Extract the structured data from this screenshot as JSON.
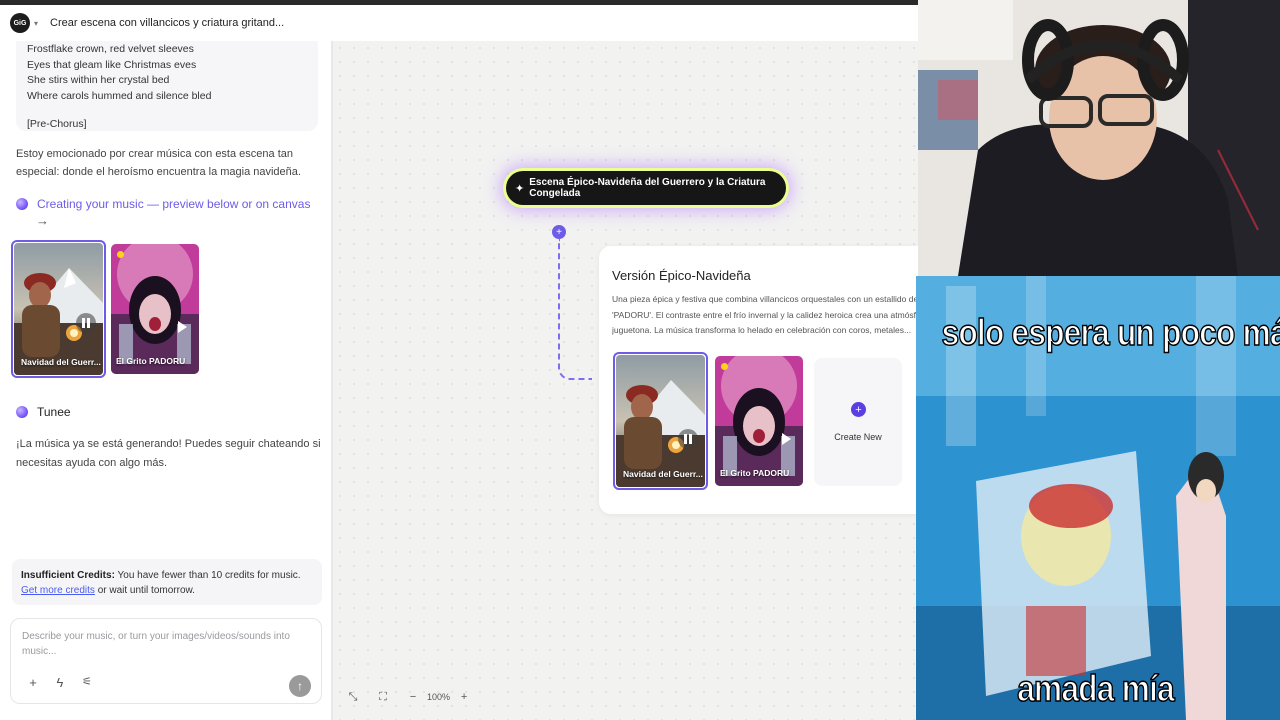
{
  "header": {
    "logo_text": "GiG",
    "title": "Crear escena con villancicos y criatura gritand..."
  },
  "chat": {
    "lyrics": [
      "Frostflake crown, red velvet sleeves",
      "Eyes that gleam like Christmas eves",
      "She stirs within her crystal bed",
      "Where carols hummed and silence bled"
    ],
    "lyrics_tag": "[Pre-Chorus]",
    "assistant_message": "Estoy emocionado por crear música con esta escena tan especial: donde el heroísmo encuentra la magia navideña.",
    "creating_label": "Creating your music — preview below or on canvas",
    "creating_arrow": "→",
    "tracks": [
      {
        "title": "Navidad del Guerr...",
        "state": "playing"
      },
      {
        "title": "El Grito PADORU",
        "state": "paused"
      }
    ],
    "tunee_name": "Tunee",
    "tunee_message": "¡La música ya se está generando! Puedes seguir chateando si necesitas ayuda con algo más.",
    "credits": {
      "bold": "Insufficient Credits:",
      "text": " You have fewer than 10 credits for music.",
      "link": "Get more credits",
      "tail": " or wait until tomorrow."
    },
    "prompt_placeholder": "Describe your music, or turn your images/videos/sounds into music..."
  },
  "canvas": {
    "scene_title": "Escena Épico-Navideña del Guerrero y la Criatura Congelada",
    "version_title": "Versión Épico-Navideña",
    "version_description": "Una pieza épica y festiva que combina villancicos orquestales con un estallido de 'PADORU'. El contraste entre el frío invernal y la calidez heroica crea una atmósfera juguetona. La música transforma lo helado en celebración con coros, metales...",
    "tracks": [
      {
        "title": "Navidad del Guerr...",
        "state": "playing"
      },
      {
        "title": "El Grito PADORU",
        "state": "paused"
      }
    ],
    "create_new_label": "Create New",
    "zoom": "100%"
  },
  "meme": {
    "top_text": "solo espera un poco más",
    "bottom_text": "amada mía"
  },
  "colors": {
    "accent": "#6c5ce7",
    "link": "#4a5cf0",
    "pill_bg": "#161616",
    "pill_glow": "#eaff8f"
  }
}
